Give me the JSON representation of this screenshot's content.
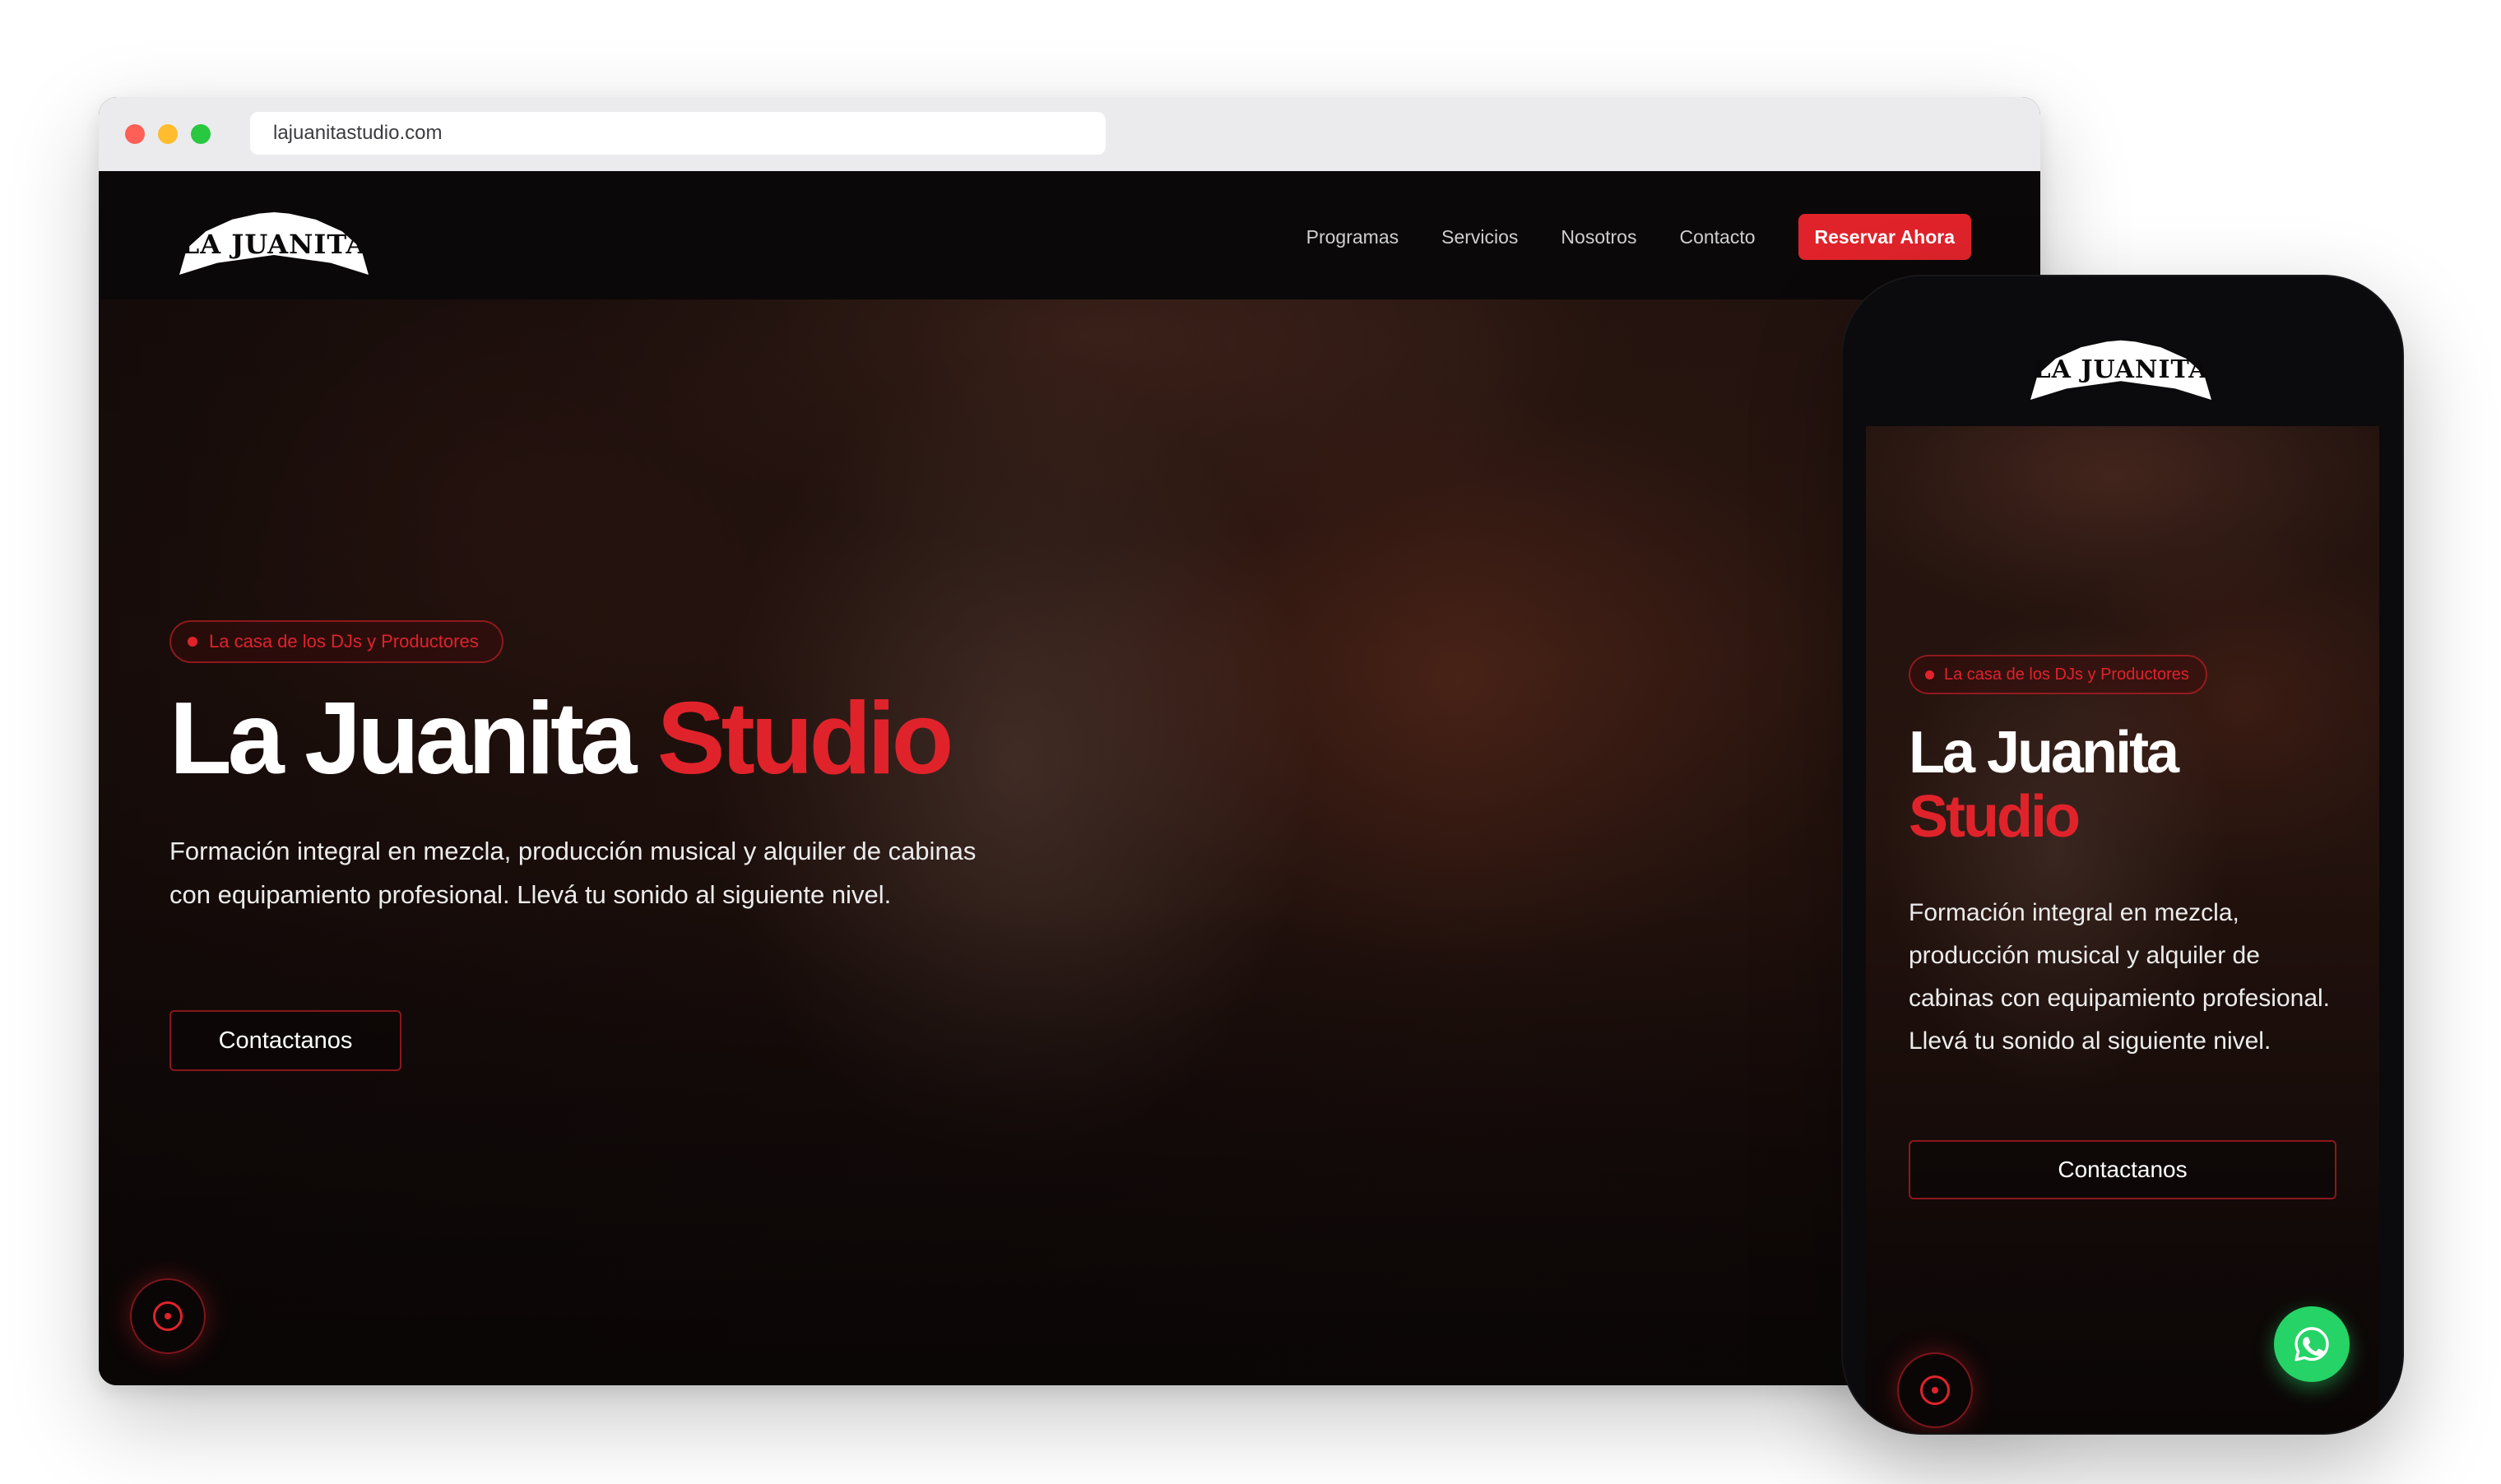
{
  "browser": {
    "url": "lajuanitastudio.com"
  },
  "brand": {
    "logo_text": "LA JUANITA",
    "accent_color": "#e0232b"
  },
  "nav": {
    "links": [
      "Programas",
      "Servicios",
      "Nosotros",
      "Contacto"
    ],
    "cta_label": "Reservar Ahora"
  },
  "hero": {
    "badge": "La casa de los DJs y Productores",
    "title_main": "La Juanita",
    "title_accent": "Studio",
    "description": "Formación integral en mezcla, producción musical y alquiler de cabinas con equipamiento profesional. Llevá tu sonido al siguiente nivel.",
    "button_label": "Contactanos"
  },
  "icons": {
    "record": "record-icon",
    "whatsapp": "whatsapp-icon",
    "whatsapp_color": "#25d366"
  }
}
